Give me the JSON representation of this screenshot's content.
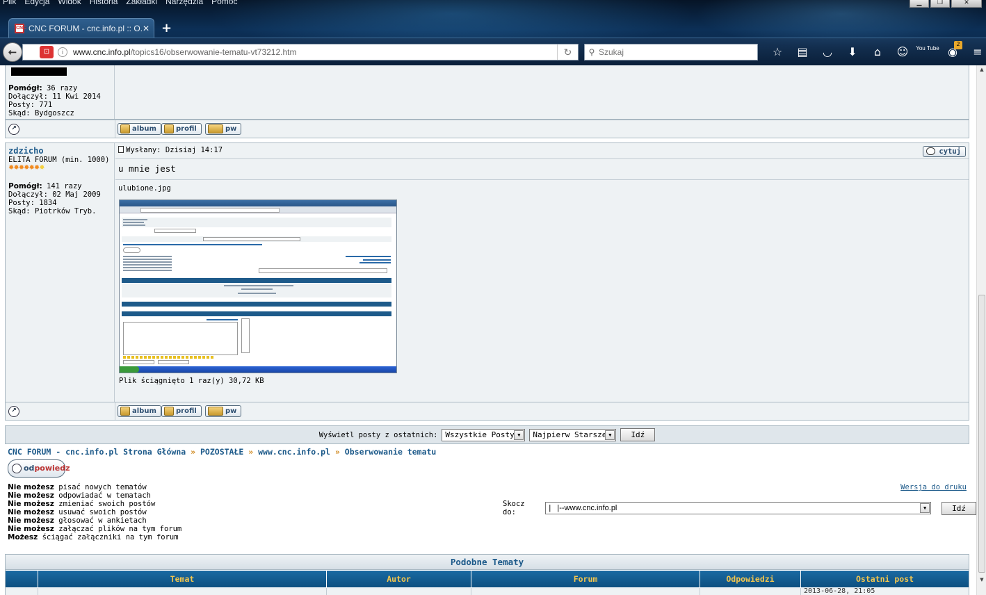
{
  "browser": {
    "menu": [
      "Plik",
      "Edycja",
      "Widok",
      "Historia",
      "Zakładki",
      "Narzędzia",
      "Pomoc"
    ],
    "tab_title": "CNC FORUM - cnc.info.pl :: O...",
    "new_tab": "+",
    "url_host": "www.cnc.info.pl",
    "url_path": "/topics16/obserwowanie-tematu-vt73212.htm",
    "search_placeholder": "Szukaj",
    "addon_badge": "2",
    "youtube_label": "You Tube"
  },
  "post1": {
    "helped_label": "Pomógł:",
    "helped_value": "36 razy",
    "joined_label": "Dołączył:",
    "joined_value": "11 Kwi 2014",
    "posts_label": "Posty:",
    "posts_value": "771",
    "from_label": "Skąd:",
    "from_value": "Bydgoszcz"
  },
  "buttons": {
    "album": "album",
    "profil": "profil",
    "pw": "pw",
    "cytuj": "cytuj"
  },
  "post2": {
    "username": "zdzicho",
    "rank": "ELITA FORUM (min. 1000)",
    "helped_label": "Pomógł:",
    "helped_value": "141 razy",
    "joined_label": "Dołączył:",
    "joined_value": "02 Maj 2009",
    "posts_label": "Posty:",
    "posts_value": "1834",
    "from_label": "Skąd:",
    "from_value": "Piotrków Tryb.",
    "posted_label": "Wysłany: Dzisiaj 14:17",
    "message": "u mnie jest",
    "attachment_name": "ulubione.jpg",
    "download_info": "Plik ściągnięto 1 raz(y) 30,72 KB"
  },
  "filter": {
    "label": "Wyświetl posty z ostatnich:",
    "period": "Wszystkie Posty",
    "order": "Najpierw Starsze",
    "go": "Idź"
  },
  "breadcrumb": {
    "home": "CNC FORUM - cnc.info.pl Strona Główna",
    "sep": "»",
    "cat": "POZOSTAŁE",
    "forum": "www.cnc.info.pl",
    "topic": "Obserwowanie tematu"
  },
  "reply": {
    "pre": "od",
    "post": "powiedz"
  },
  "permissions": [
    {
      "bold": "Nie możesz",
      "text": "pisać nowych tematów"
    },
    {
      "bold": "Nie możesz",
      "text": "odpowiadać w tematach"
    },
    {
      "bold": "Nie możesz",
      "text": "zmieniać swoich postów"
    },
    {
      "bold": "Nie możesz",
      "text": "usuwać swoich postów"
    },
    {
      "bold": "Nie możesz",
      "text": "głosować w ankietach"
    },
    {
      "bold": "Nie możesz",
      "text": "załączać plików na tym forum"
    },
    {
      "bold": "Możesz",
      "text": "ściągać załączniki na tym forum"
    }
  ],
  "print_link": "Wersja do druku",
  "jump": {
    "label": "Skocz do:",
    "value": "|   |--www.cnc.info.pl",
    "go": "Idź"
  },
  "similar": {
    "title": "Podobne Tematy",
    "columns": [
      "Temat",
      "Autor",
      "Forum",
      "Odpowiedzi",
      "Ostatni post"
    ],
    "partial_date": "2013-06-28, 21:05"
  }
}
